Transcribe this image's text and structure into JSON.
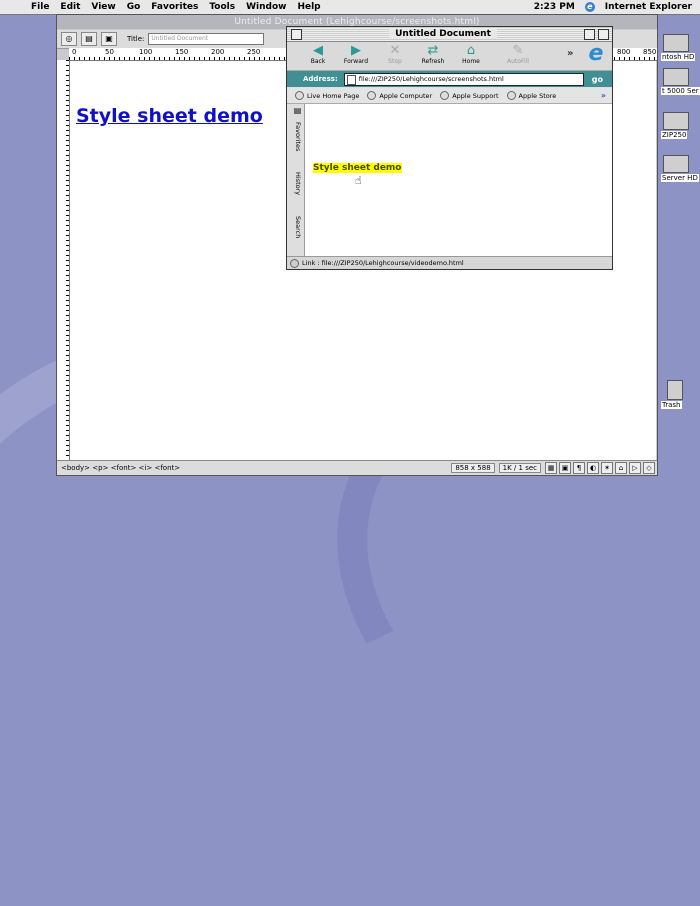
{
  "menubar": {
    "apple_icon": "apple-menu",
    "items": [
      "File",
      "Edit",
      "View",
      "Go",
      "Favorites",
      "Tools",
      "Window",
      "Help"
    ],
    "clock": "2:23 PM",
    "app_name": "Internet Explorer"
  },
  "desktop": {
    "icons": [
      "ntosh HD",
      "t 5000 Ser",
      "ZIP250",
      "Server HD",
      "Trash"
    ]
  },
  "dreamweaver": {
    "window_title": "Untitled Document (Lehighcourse/screenshots.html)",
    "title_label": "Title:",
    "title_value": "Untitled Document",
    "ruler_numbers": [
      "0",
      "50",
      "100",
      "150",
      "200",
      "250",
      "800",
      "850"
    ],
    "heading": "Style sheet demo",
    "tag_selector": "<body> <p> <font> <i> <font>",
    "window_size": "858 x 588",
    "download_time": "1K / 1 sec"
  },
  "ie": {
    "window_title": "Untitled Document",
    "nav": {
      "back": "Back",
      "forward": "Forward",
      "stop": "Stop",
      "refresh": "Refresh",
      "home": "Home",
      "autofill": "AutoFill",
      "more": "»"
    },
    "address_label": "Address:",
    "address_value": "file:///ZIP250/Lehighcourse/screenshots.html",
    "go_label": "go",
    "links": [
      "Live Home Page",
      "Apple Computer",
      "Apple Support",
      "Apple Store"
    ],
    "links_more": "»",
    "side_tabs": [
      "Favorites",
      "History",
      "Search"
    ],
    "content_text": "Style sheet demo",
    "status_text": "Link : file:///ZIP250/Lehighcourse/videodemo.html"
  }
}
